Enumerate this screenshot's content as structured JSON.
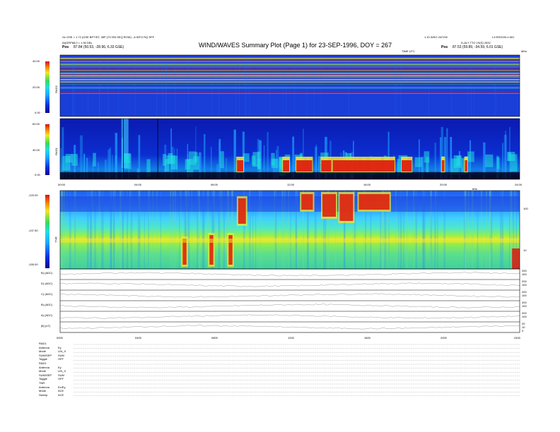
{
  "header": {
    "title": "WIND/WAVES Summary Plot (Page 1) for 23-SEP-1996, DOY = 267",
    "left_line1": "Xe GSE = 1.72 (GSE BPTIST, 35P (TO EB SEQ ROW) - A INTO RQ SPF",
    "left_line2": "At(GRP68.0 = 1.90 DB)",
    "left_pos_label": "Pos",
    "left_pos_value": "87.84 (50.53, -28.96, 6.33 GSE)",
    "right_line1": "1.10 WSO 24/7/00",
    "right_line1b": "L3 ERGON e 601",
    "right_line2": "D-ALY TTO 1S(S) 2532",
    "right_pos_label": "Pos",
    "right_pos_value": "87.53 (59.89, -34.59, 6.01 GSE)",
    "freq_unit_tr": "MHz",
    "time_unit_top": "TIME UTC"
  },
  "panels": {
    "rad2": {
      "label": "RAD2",
      "y_ticks": [
        "40.00",
        "20.00",
        "0.00"
      ],
      "color_range": [
        0,
        40
      ]
    },
    "rad1": {
      "label": "RAD1",
      "y_ticks": [
        "60.00",
        "30.00",
        "0.00"
      ],
      "color_range": [
        0,
        60
      ],
      "x_ticks": [
        "00:00",
        "04:00",
        "08:00",
        "12:00",
        "16:00",
        "20:00",
        "24:00"
      ]
    },
    "tnr": {
      "label": "TNR",
      "y_ticks": [
        "-120.00",
        "-137.50",
        "-155.00"
      ],
      "right_ticks": [
        "100",
        "10"
      ],
      "unit": "kHz",
      "color_range": [
        -155,
        -120
      ]
    },
    "lines": [
      {
        "label": "B) (ADC)",
        "right": [
          "200",
          "100"
        ]
      },
      {
        "label": "D) (ADC)",
        "right": [
          "200",
          "100"
        ]
      },
      {
        "label": "C) (ADC)",
        "right": [
          "200",
          "100"
        ]
      },
      {
        "label": "B) (ADC)",
        "right": [
          "200",
          "100"
        ]
      },
      {
        "label": "A) (ADC)",
        "right": [
          "200",
          "100"
        ]
      },
      {
        "label": "|B| (nT)",
        "right": [
          "20",
          "10",
          "0"
        ]
      }
    ],
    "bottom_x_ticks": [
      "0000",
      "0400",
      "0800",
      "1200",
      "1600",
      "2000",
      "2400"
    ]
  },
  "modes": [
    {
      "k": "RAD1",
      "v": ""
    },
    {
      "k": "Antenna",
      "v": "Ey"
    },
    {
      "k": "Mode",
      "v": "LIN_X"
    },
    {
      "k": "SUM/SEP",
      "v": "SUM"
    },
    {
      "k": "Toggle",
      "v": "OFF"
    },
    {
      "k": "RAD1",
      "v": ""
    },
    {
      "k": "Antenna",
      "v": "Ey"
    },
    {
      "k": "Mode",
      "v": "LIN_X"
    },
    {
      "k": "SUM/SEP",
      "v": "SUM"
    },
    {
      "k": "Toggle",
      "v": "OFF"
    },
    {
      "k": "TNR",
      "v": ""
    },
    {
      "k": "Antenna",
      "v": "Ex/Ey"
    },
    {
      "k": "Mode",
      "v": "ACE"
    },
    {
      "k": "Sweep",
      "v": "ACE"
    }
  ],
  "colors": {
    "low": "#0b12c9",
    "mid": "#1fa8ff",
    "green": "#38d85a",
    "yellow": "#f0e82a",
    "red": "#e0160b"
  }
}
